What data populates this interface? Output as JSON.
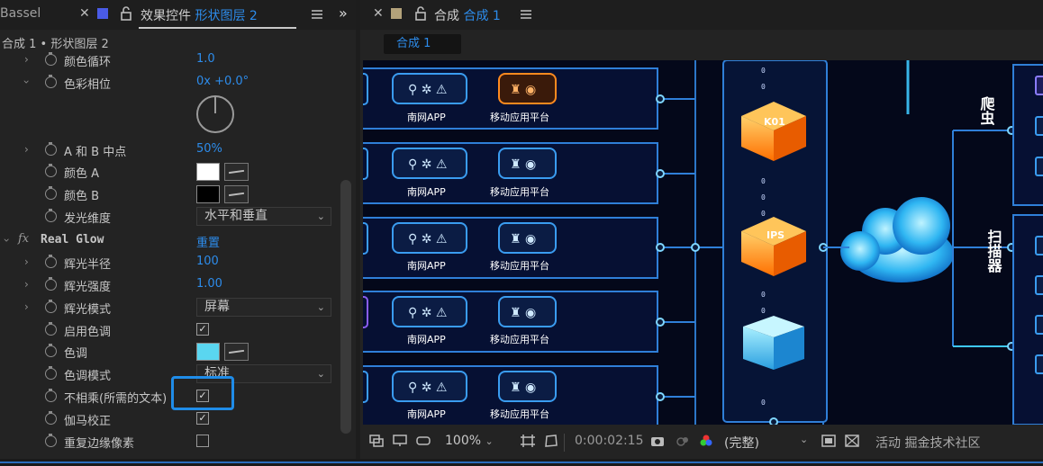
{
  "left_panel": {
    "prev_tab": "Bassel",
    "tab_title_prefix": "效果控件",
    "tab_title_layer": "形状图层 2",
    "subtitle": "合成 1 • 形状图层 2",
    "properties": [
      {
        "label": "颜色循环",
        "value": "1.0"
      },
      {
        "label": "色彩相位",
        "value": "0x +0.0°"
      },
      {
        "label": "A 和 B 中点",
        "value": "50%"
      },
      {
        "label": "颜色 A",
        "color": "#ffffff"
      },
      {
        "label": "颜色 B",
        "color": "#000000"
      },
      {
        "label": "发光维度",
        "dropdown": "水平和垂直"
      }
    ],
    "effect": {
      "name": "Real Glow",
      "reset": "重置",
      "fx": "fx"
    },
    "effect_properties": [
      {
        "label": "辉光半径",
        "value": "100"
      },
      {
        "label": "辉光强度",
        "value": "1.00"
      },
      {
        "label": "辉光模式",
        "dropdown": "屏幕"
      },
      {
        "label": "启用色调",
        "checked": true
      },
      {
        "label": "色调",
        "color": "#5ad6f0"
      },
      {
        "label": "色调模式",
        "dropdown": "标准"
      },
      {
        "label": "不相乘(所需的文本)",
        "checked": true
      },
      {
        "label": "伽马校正",
        "checked": true
      },
      {
        "label": "重复边缘像素",
        "checked": false
      }
    ]
  },
  "comp_panel": {
    "tab_prefix": "合成",
    "tab_comp": "合成 1",
    "breadcrumb": "合成 1",
    "diagram": {
      "app_labels": [
        "南网APP",
        "移动应用平台"
      ],
      "firewall_labels": [
        "K01",
        "IPS"
      ],
      "side_labels": [
        "爬虫",
        "扫描器"
      ],
      "dot_char": "0"
    },
    "footer": {
      "zoom": "100%",
      "timecode": "0:00:02:15",
      "resolution": "(完整)",
      "watermark": "活动 掘金技术社区"
    }
  },
  "colors": {
    "accent_blue": "#2d8ceb",
    "neon_cyan": "#3ec8ff",
    "neon_orange": "#ff8a1f",
    "highlight_blue": "#1f8ce8"
  }
}
